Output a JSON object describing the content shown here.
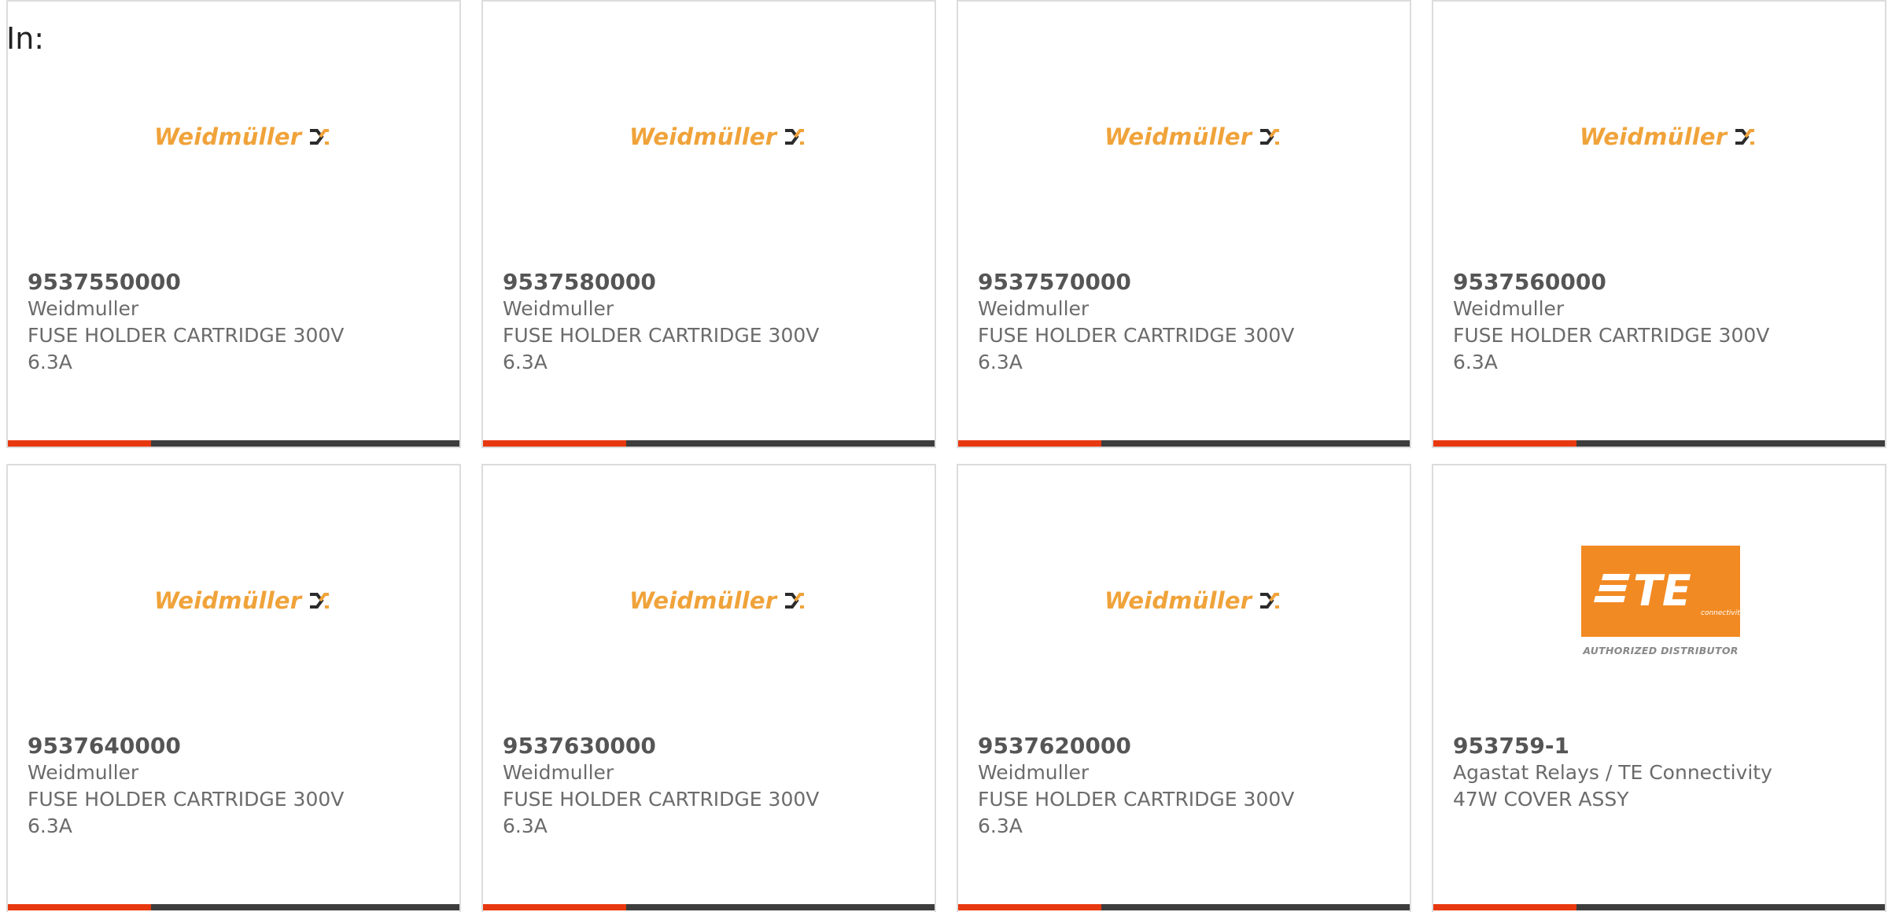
{
  "header": {
    "in_label": "In:"
  },
  "colors": {
    "accent_bar": "#e8380f",
    "bar_dark": "#3d3d3d",
    "weidmuller_orange": "#f0a33a",
    "te_orange": "#f28a23"
  },
  "logos": {
    "weidmuller_text": "Weidmüller",
    "te_text": "TE",
    "te_sub": "connectivity",
    "te_authorized": "AUTHORIZED DISTRIBUTOR"
  },
  "products": [
    {
      "part_number": "9537550000",
      "manufacturer": "Weidmuller",
      "desc1": "FUSE HOLDER CARTRIDGE 300V",
      "desc2": "6.3A",
      "logo": "weidmuller-logo"
    },
    {
      "part_number": "9537580000",
      "manufacturer": "Weidmuller",
      "desc1": "FUSE HOLDER CARTRIDGE 300V",
      "desc2": "6.3A",
      "logo": "weidmuller-logo"
    },
    {
      "part_number": "9537570000",
      "manufacturer": "Weidmuller",
      "desc1": "FUSE HOLDER CARTRIDGE 300V",
      "desc2": "6.3A",
      "logo": "weidmuller-logo"
    },
    {
      "part_number": "9537560000",
      "manufacturer": "Weidmuller",
      "desc1": "FUSE HOLDER CARTRIDGE 300V",
      "desc2": "6.3A",
      "logo": "weidmuller-logo"
    },
    {
      "part_number": "9537640000",
      "manufacturer": "Weidmuller",
      "desc1": "FUSE HOLDER CARTRIDGE 300V",
      "desc2": "6.3A",
      "logo": "weidmuller-logo"
    },
    {
      "part_number": "9537630000",
      "manufacturer": "Weidmuller",
      "desc1": "FUSE HOLDER CARTRIDGE 300V",
      "desc2": "6.3A",
      "logo": "weidmuller-logo"
    },
    {
      "part_number": "9537620000",
      "manufacturer": "Weidmuller",
      "desc1": "FUSE HOLDER CARTRIDGE 300V",
      "desc2": "6.3A",
      "logo": "weidmuller-logo"
    },
    {
      "part_number": "953759-1",
      "manufacturer": "Agastat Relays / TE Connectivity",
      "desc1": "47W COVER ASSY",
      "desc2": "",
      "logo": "te-connectivity-logo"
    }
  ]
}
